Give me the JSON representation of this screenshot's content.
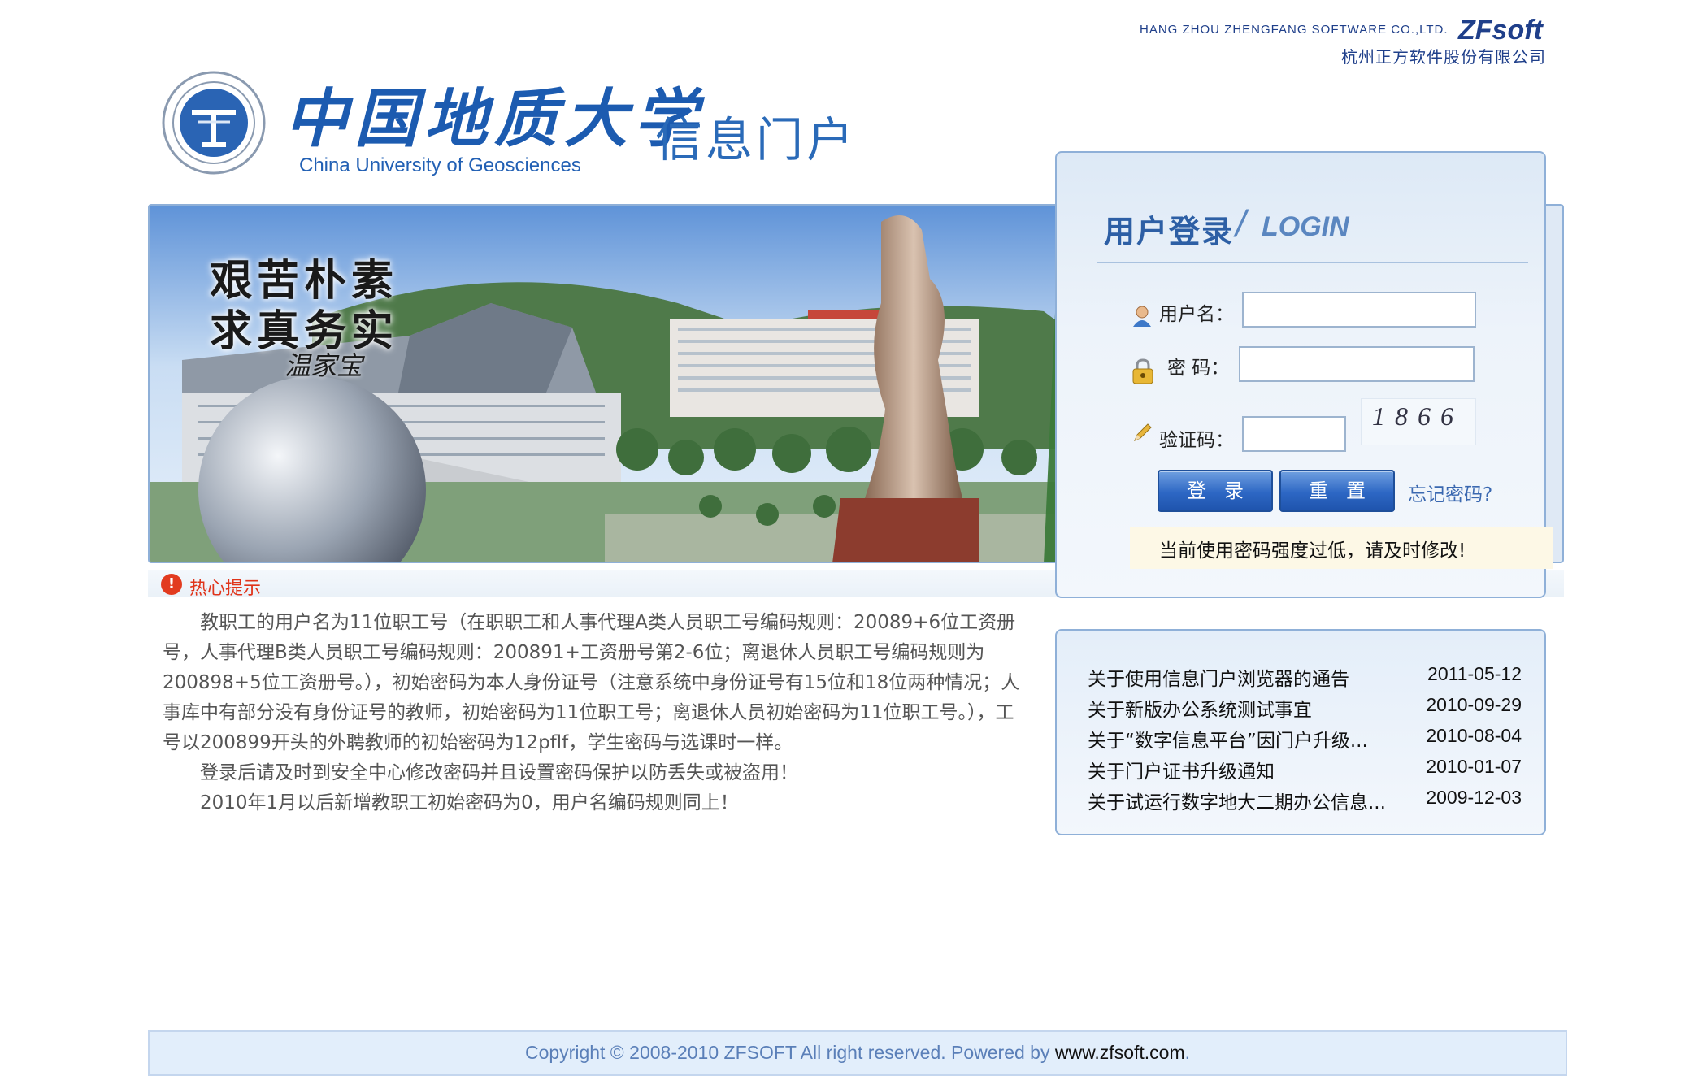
{
  "header": {
    "vendor_en": "HANG ZHOU ZHENGFANG SOFTWARE CO.,LTD.",
    "vendor_brand": "ZFsoft",
    "vendor_cn": "杭州正方软件股份有限公司",
    "university_cn": "中国地质大学",
    "university_en": "China University of Geosciences",
    "portal_title": "信息门户"
  },
  "banner": {
    "motto_line1": "艰苦朴素",
    "motto_line2": "求真务实",
    "motto_sign": "温家宝"
  },
  "tip": {
    "title": "热心提示",
    "paragraphs": [
      "教职工的用户名为11位职工号（在职职工和人事代理A类人员职工号编码规则：20089+6位工资册号，人事代理B类人员职工号编码规则：200891+工资册号第2-6位；离退休人员职工号编码规则为200898+5位工资册号。），初始密码为本人身份证号（注意系统中身份证号有15位和18位两种情况；人事库中有部分没有身份证号的教师，初始密码为11位职工号；离退休人员初始密码为11位职工号。），工号以200899开头的外聘教师的初始密码为12pflf，学生密码与选课时一样。",
      "登录后请及时到安全中心修改密码并且设置密码保护以防丢失或被盗用！",
      "2010年1月以后新增教职工初始密码为0，用户名编码规则同上！"
    ]
  },
  "login": {
    "title_cn": "用户登录",
    "title_slash": "/",
    "title_en": "LOGIN",
    "username_label": "用户名：",
    "username_value": "",
    "password_label": "密 码：",
    "password_value": "",
    "captcha_label": "验证码：",
    "captcha_value": "",
    "captcha_image_text": "1866",
    "login_button": "登录",
    "reset_button": "重置",
    "forgot_link": "忘记密码?",
    "warning": "当前使用密码强度过低，请及时修改!"
  },
  "news": [
    {
      "title": "关于使用信息门户浏览器的通告",
      "date": "2011-05-12"
    },
    {
      "title": "关于新版办公系统测试事宜",
      "date": "2010-09-29"
    },
    {
      "title": "关于“数字信息平台”因门户升级...",
      "date": "2010-08-04"
    },
    {
      "title": "关于门户证书升级通知",
      "date": "2010-01-07"
    },
    {
      "title": "关于试运行数字地大二期办公信息...",
      "date": "2009-12-03"
    }
  ],
  "footer": {
    "copyright": "Copyright © 2008-2010 ZFSOFT All right reserved. Powered by ",
    "domain": "www.zfsoft.com",
    "trailing": "."
  },
  "colors": {
    "brand_blue": "#1c5bb0",
    "button_blue": "#2d67c4",
    "tip_red": "#e0341a",
    "footer_bg": "#e2eefb"
  }
}
